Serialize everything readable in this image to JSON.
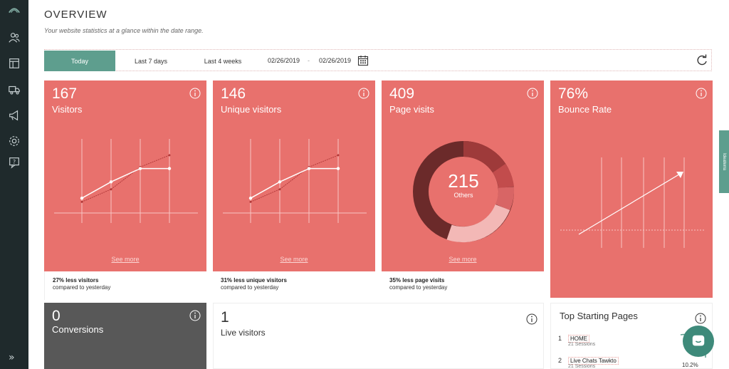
{
  "header": {
    "title": "OVERVIEW",
    "subtitle": "Your website statistics at a glance within the date range."
  },
  "toolbar": {
    "tabs": [
      {
        "label": "Today",
        "active": true
      },
      {
        "label": "Last 7 days",
        "active": false
      },
      {
        "label": "Last 4 weeks",
        "active": false
      }
    ],
    "date_from": "02/26/2019",
    "date_sep": "-",
    "date_to": "02/26/2019"
  },
  "cards": {
    "visitors": {
      "value": "167",
      "label": "Visitors",
      "see_more": "See more",
      "footer_line1": "27% less visitors",
      "footer_line2": "compared to yesterday",
      "trend_today": [
        0.2,
        0.42,
        0.6,
        0.6
      ],
      "trend_yesterday": [
        0.15,
        0.32,
        0.62,
        0.78
      ]
    },
    "unique": {
      "value": "146",
      "label": "Unique visitors",
      "see_more": "See more",
      "footer_line1": "31% less unique visitors",
      "footer_line2": "compared to yesterday",
      "trend_today": [
        0.2,
        0.42,
        0.6,
        0.6
      ],
      "trend_yesterday": [
        0.15,
        0.32,
        0.62,
        0.78
      ]
    },
    "pages": {
      "value": "409",
      "label": "Page visits",
      "see_more": "See more",
      "footer_line1": "35% less page visits",
      "footer_line2": "compared to yesterday",
      "donut_value": "215",
      "donut_label": "Others"
    },
    "bounce": {
      "value": "76%",
      "label": "Bounce Rate"
    },
    "conversions": {
      "value": "0",
      "label": "Conversions"
    },
    "live": {
      "value": "1",
      "label": "Live visitors"
    },
    "top_pages": {
      "title": "Top Starting Pages",
      "rows": [
        {
          "index": "1",
          "name": "HOME",
          "sessions": "21 Sessions"
        },
        {
          "index": "2",
          "name": "Live Chats Tawkto",
          "sessions": "21 Sessions"
        }
      ],
      "percent": "10.2%"
    }
  },
  "side_tab": "Ideaterra",
  "colors": {
    "card": "#e8716d",
    "accent": "#5e9e8e",
    "sidebar": "#1f2a2c",
    "dark_card": "#585858"
  }
}
